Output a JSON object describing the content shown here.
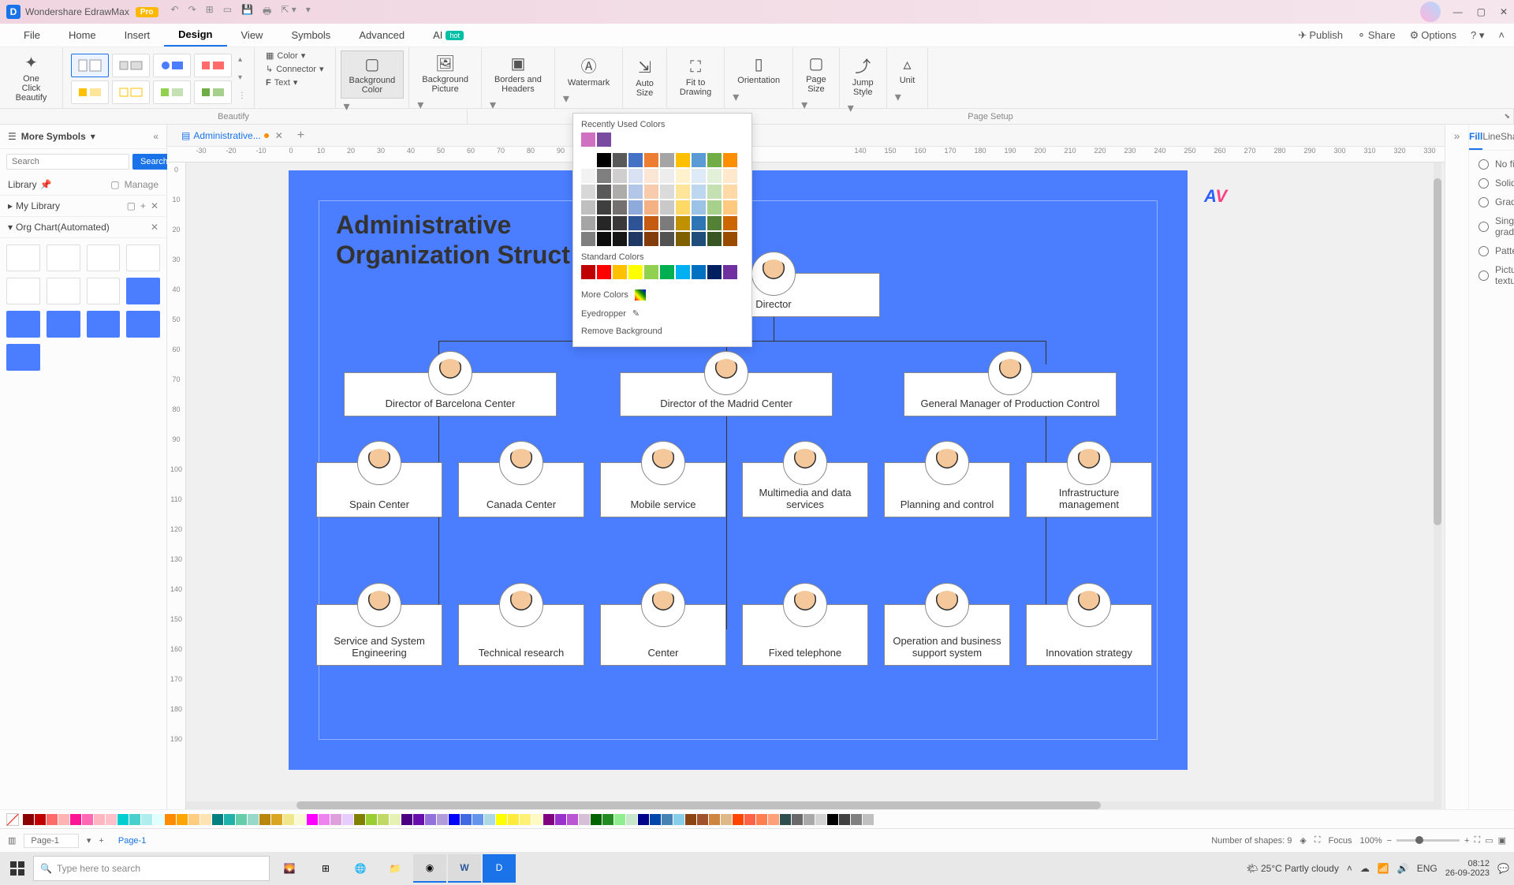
{
  "app": {
    "title": "Wondershare EdrawMax",
    "pro_badge": "Pro"
  },
  "menu": {
    "items": [
      "File",
      "Home",
      "Insert",
      "Design",
      "View",
      "Symbols",
      "Advanced",
      "AI"
    ],
    "active": "Design",
    "hot_badge": "hot",
    "right": {
      "publish": "Publish",
      "share": "Share",
      "options": "Options"
    }
  },
  "ribbon": {
    "one_click": "One Click\nBeautify",
    "color": "Color",
    "connector": "Connector",
    "text": "Text",
    "bg_color": "Background\nColor",
    "bg_picture": "Background\nPicture",
    "borders": "Borders and\nHeaders",
    "watermark": "Watermark",
    "auto_size": "Auto\nSize",
    "fit_drawing": "Fit to\nDrawing",
    "orientation": "Orientation",
    "page_size": "Page\nSize",
    "jump_style": "Jump\nStyle",
    "unit": "Unit",
    "group_beautify": "Beautify",
    "group_pagesetup": "Page Setup"
  },
  "left": {
    "header": "More Symbols",
    "search_placeholder": "Search",
    "search_btn": "Search",
    "library": "Library",
    "manage": "Manage",
    "mylibrary": "My Library",
    "orgchart": "Org Chart(Automated)"
  },
  "tabs": {
    "doc_name": "Administrative..."
  },
  "ruler_h": [
    "-30",
    "-20",
    "-10",
    "0",
    "10",
    "20",
    "30",
    "40",
    "50",
    "60",
    "70",
    "80",
    "90",
    "",
    "",
    "",
    "",
    "",
    "",
    "",
    "",
    "",
    "140",
    "150",
    "160",
    "170",
    "180",
    "190",
    "200",
    "210",
    "220",
    "230",
    "240",
    "250",
    "260",
    "270",
    "280",
    "290",
    "300",
    "310",
    "320",
    "330"
  ],
  "ruler_v": [
    "0",
    "10",
    "20",
    "30",
    "40",
    "50",
    "60",
    "70",
    "80",
    "90",
    "100",
    "110",
    "120",
    "130",
    "140",
    "150",
    "160",
    "170",
    "180",
    "190"
  ],
  "chart_data": {
    "type": "org-chart",
    "title": "Administrative\nOrganization Struct",
    "root": "Director",
    "level2": [
      "Director of Barcelona Center",
      "Director of the Madrid Center",
      "General Manager of Production Control"
    ],
    "level3": [
      "Spain Center",
      "Canada Center",
      "Mobile service",
      "Multimedia and data services",
      "Planning and control",
      "Infrastructure management"
    ],
    "level4": [
      "Service and System Engineering",
      "Technical research",
      "Center",
      "Fixed telephone",
      "Operation and business support system",
      "Innovation strategy"
    ]
  },
  "colorpopup": {
    "recent_label": "Recently Used Colors",
    "recent": [
      "#d070c0",
      "#7a4aa0"
    ],
    "theme": [
      [
        "#ffffff",
        "#000000",
        "#595959",
        "#4472c4",
        "#ed7d31",
        "#a5a5a5",
        "#ffc000",
        "#5b9bd5",
        "#70ad47",
        "#ff8f00"
      ],
      [
        "#f2f2f2",
        "#7f7f7f",
        "#d0cece",
        "#d9e2f3",
        "#fbe5d5",
        "#ededed",
        "#fff2cc",
        "#deebf6",
        "#e2efd9",
        "#ffe8cc"
      ],
      [
        "#d8d8d8",
        "#595959",
        "#aeabab",
        "#b4c6e7",
        "#f7cbac",
        "#dbdbdb",
        "#fee599",
        "#bdd7ee",
        "#c5e0b3",
        "#ffd9a6"
      ],
      [
        "#bfbfbf",
        "#3f3f3f",
        "#757070",
        "#8eaadb",
        "#f4b183",
        "#c9c9c9",
        "#ffd965",
        "#9cc3e5",
        "#a8d08d",
        "#ffc980"
      ],
      [
        "#a5a5a5",
        "#262626",
        "#3a3838",
        "#2f5496",
        "#c55a11",
        "#7b7b7b",
        "#bf9000",
        "#2e75b5",
        "#538135",
        "#cc6600"
      ],
      [
        "#7f7f7f",
        "#0c0c0c",
        "#171616",
        "#1f3864",
        "#833c0b",
        "#525252",
        "#7f6000",
        "#1e4e79",
        "#375623",
        "#994c00"
      ]
    ],
    "standard_label": "Standard Colors",
    "standard": [
      "#c00000",
      "#ff0000",
      "#ffc000",
      "#ffff00",
      "#92d050",
      "#00b050",
      "#00b0f0",
      "#0070c0",
      "#002060",
      "#7030a0"
    ],
    "more_colors": "More Colors",
    "eyedropper": "Eyedropper",
    "remove_bg": "Remove Background"
  },
  "right": {
    "tabs": [
      "Fill",
      "Line",
      "Shadow"
    ],
    "active": "Fill",
    "opts": [
      "No fill",
      "Solid fill",
      "Gradient fill",
      "Single color gradient fill",
      "Pattern fill",
      "Picture or texture fill"
    ]
  },
  "colorstrip": [
    "#8b0000",
    "#c00000",
    "#ff6b6b",
    "#ffb3b3",
    "#ff1493",
    "#ff69b4",
    "#ffb6c1",
    "#ffc0cb",
    "#00ced1",
    "#48d1cc",
    "#afeeee",
    "#e0ffff",
    "#ff8c00",
    "#ffa500",
    "#ffcc80",
    "#ffe4b3",
    "#008080",
    "#20b2aa",
    "#66cdaa",
    "#98d8c8",
    "#b8860b",
    "#daa520",
    "#f0e68c",
    "#fafad2",
    "#ff00ff",
    "#ee82ee",
    "#dda0dd",
    "#e6ccff",
    "#808000",
    "#9acd32",
    "#c0d966",
    "#e6f2b3",
    "#4b0082",
    "#6a0dad",
    "#9370db",
    "#b19cd9",
    "#0000ff",
    "#4169e1",
    "#6495ed",
    "#add8e6",
    "#ffff00",
    "#ffeb3b",
    "#fff176",
    "#fff9c4",
    "#800080",
    "#9932cc",
    "#ba55d3",
    "#d8bfd8",
    "#006400",
    "#228b22",
    "#90ee90",
    "#c8e6c9",
    "#00008b",
    "#0047ab",
    "#4682b4",
    "#87ceeb",
    "#8b4513",
    "#a0522d",
    "#cd853f",
    "#deb887",
    "#ff4500",
    "#ff6347",
    "#ff7f50",
    "#ffa07a",
    "#2f4f4f",
    "#696969",
    "#a9a9a9",
    "#d3d3d3",
    "#000000",
    "#404040",
    "#808080",
    "#c0c0c0"
  ],
  "status": {
    "page_sel": "Page-1",
    "page_tab": "Page-1",
    "shapes": "Number of shapes: 9",
    "focus": "Focus",
    "zoom": "100%"
  },
  "taskbar": {
    "search_placeholder": "Type here to search",
    "weather": "25°C  Partly cloudy",
    "time": "08:12",
    "date": "26-09-2023"
  }
}
